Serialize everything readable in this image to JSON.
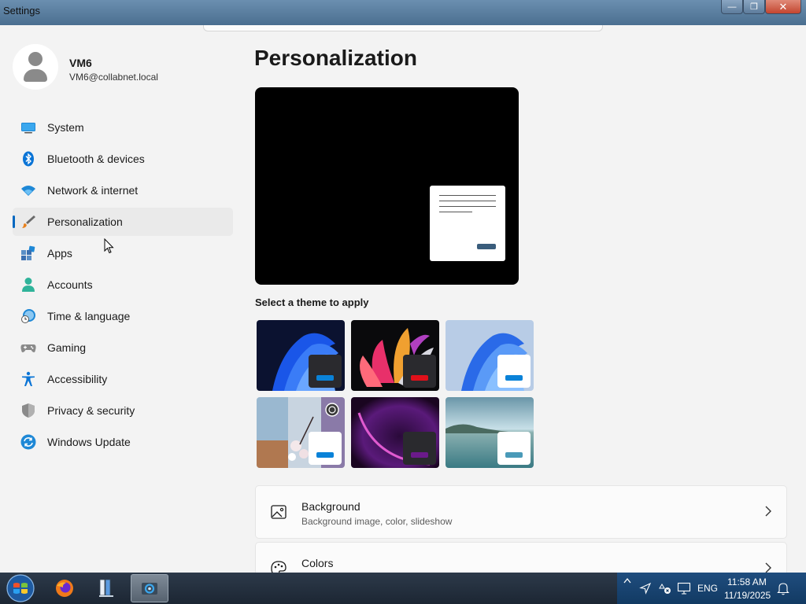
{
  "window": {
    "title": "Settings",
    "close_glyph": "✕",
    "minimize_glyph": "—",
    "maximize_glyph": "❐"
  },
  "user": {
    "name": "VM6",
    "email": "VM6@collabnet.local",
    "avatar_icon": "person-icon"
  },
  "sidebar": {
    "selected_index": 3,
    "items": [
      {
        "label": "System",
        "icon": "monitor-icon"
      },
      {
        "label": "Bluetooth & devices",
        "icon": "bluetooth-icon"
      },
      {
        "label": "Network & internet",
        "icon": "wifi-icon"
      },
      {
        "label": "Personalization",
        "icon": "brush-icon"
      },
      {
        "label": "Apps",
        "icon": "apps-icon"
      },
      {
        "label": "Accounts",
        "icon": "account-icon"
      },
      {
        "label": "Time & language",
        "icon": "clock-globe-icon"
      },
      {
        "label": "Gaming",
        "icon": "gamepad-icon"
      },
      {
        "label": "Accessibility",
        "icon": "accessibility-icon"
      },
      {
        "label": "Privacy & security",
        "icon": "shield-icon"
      },
      {
        "label": "Windows Update",
        "icon": "update-icon"
      }
    ]
  },
  "main": {
    "title": "Personalization",
    "theme_section_label": "Select a theme to apply",
    "themes": [
      {
        "name": "windows-light-bloom",
        "accent": "#0078d4"
      },
      {
        "name": "glow",
        "accent": "#e0101a"
      },
      {
        "name": "windows-light",
        "accent": "#0078d4"
      },
      {
        "name": "flowers-spotlight",
        "accent": "#0078d4"
      },
      {
        "name": "captured-motion",
        "accent": "#6b1a8a"
      },
      {
        "name": "sunrise-lake",
        "accent": "#4a9ab8"
      }
    ],
    "cards": [
      {
        "title": "Background",
        "subtitle": "Background image, color, slideshow",
        "icon": "image-icon"
      },
      {
        "title": "Colors",
        "subtitle": "",
        "icon": "palette-icon"
      }
    ]
  },
  "taskbar": {
    "items": [
      "start-orb",
      "firefox",
      "file-manager",
      "settings"
    ],
    "language": "ENG",
    "time": "11:58 AM",
    "date": "11/19/2025"
  },
  "colors": {
    "accent": "#0067c0",
    "titlebar": "#5a7fa3",
    "taskbar": "#1c2633"
  }
}
